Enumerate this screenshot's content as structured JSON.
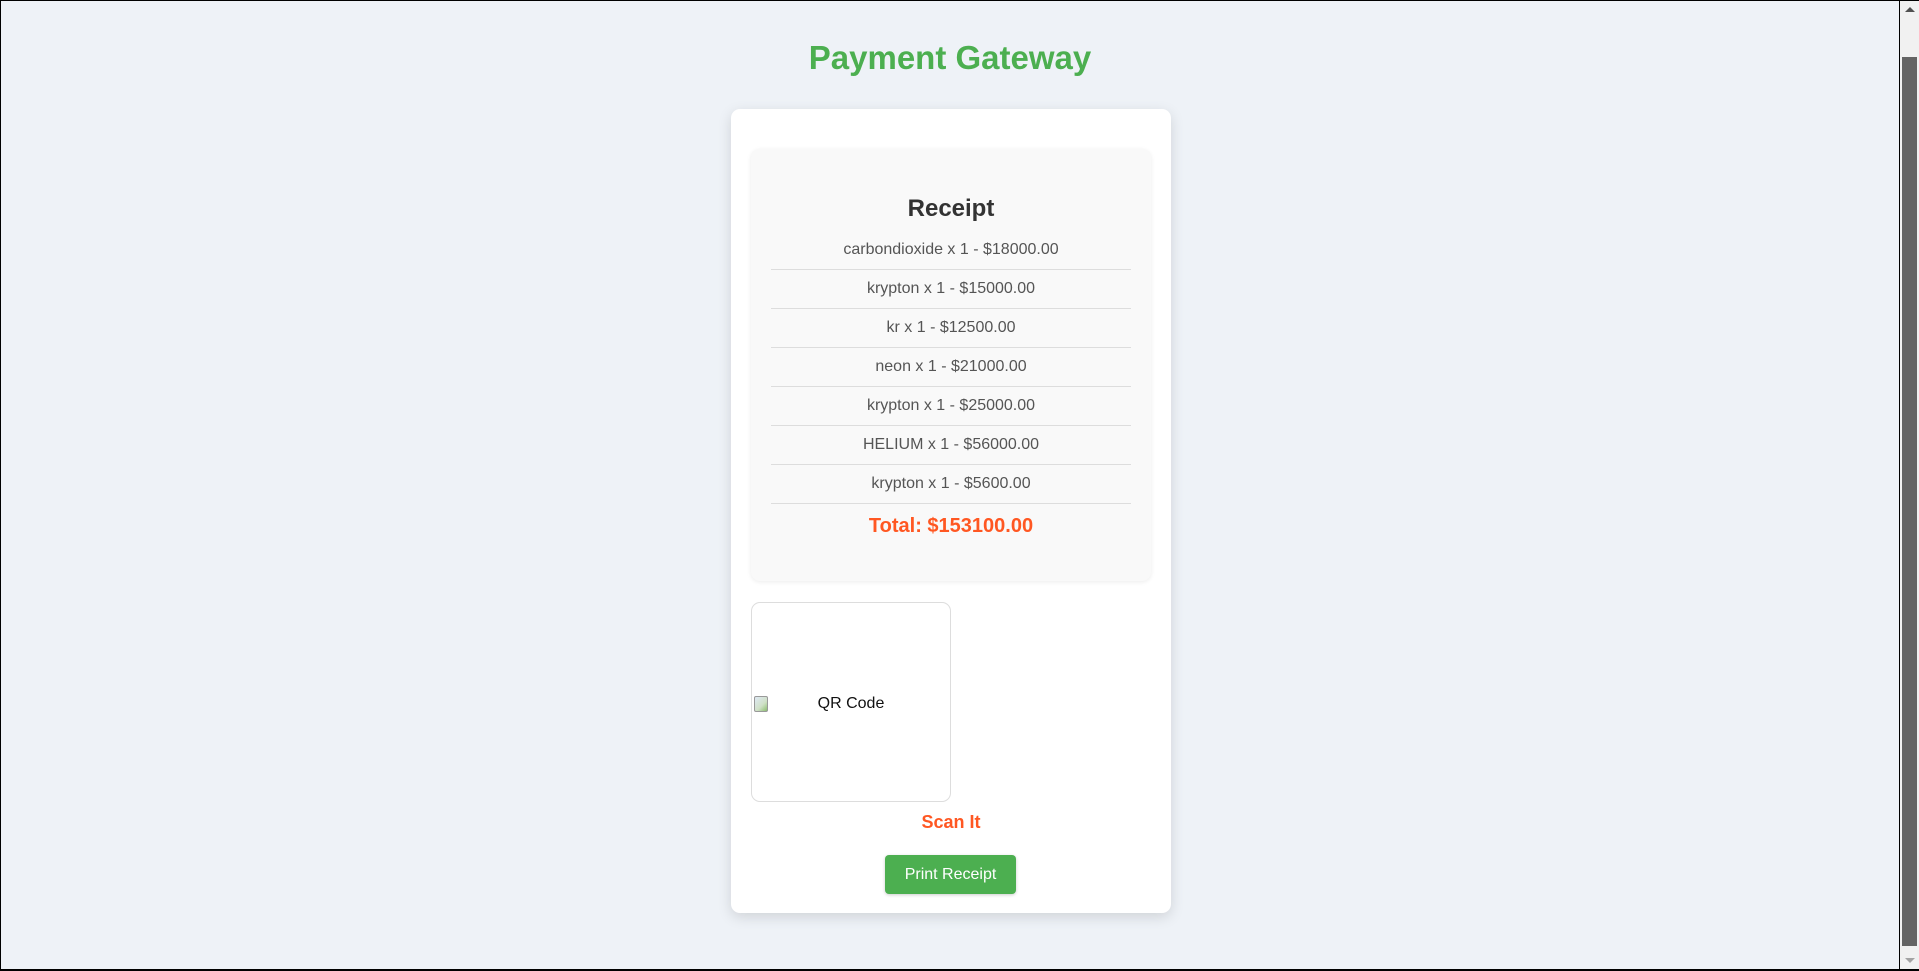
{
  "page": {
    "title": "Payment Gateway"
  },
  "receipt": {
    "title": "Receipt",
    "items": [
      "carbondioxide x 1 - $18000.00",
      "krypton x 1 - $15000.00",
      "kr x 1 - $12500.00",
      "neon x 1 - $21000.00",
      "krypton x 1 - $25000.00",
      "HELIUM x 1 - $56000.00",
      "krypton x 1 - $5600.00"
    ],
    "total": "Total: $153100.00"
  },
  "qr": {
    "alt_text": "QR Code",
    "scan_label": "Scan It"
  },
  "actions": {
    "print_label": "Print Receipt"
  },
  "colors": {
    "brand_green": "#4caf50",
    "accent_orange": "#ff5722",
    "background": "#eef2f7"
  },
  "icons": {
    "broken_image": "broken-image-icon",
    "scroll_up": "scroll-up-arrow-icon",
    "scroll_down": "scroll-down-arrow-icon"
  }
}
